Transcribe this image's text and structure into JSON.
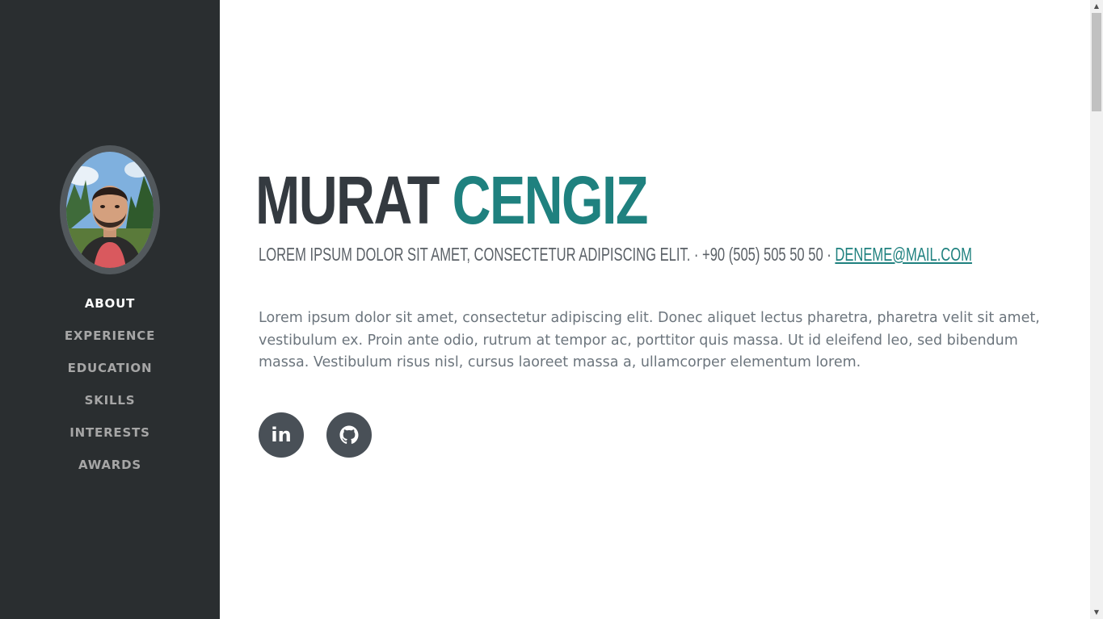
{
  "sidebar": {
    "avatar_alt": "Profile photo",
    "nav": [
      {
        "label": "ABOUT",
        "active": true
      },
      {
        "label": "EXPERIENCE",
        "active": false
      },
      {
        "label": "EDUCATION",
        "active": false
      },
      {
        "label": "SKILLS",
        "active": false
      },
      {
        "label": "INTERESTS",
        "active": false
      },
      {
        "label": "AWARDS",
        "active": false
      }
    ]
  },
  "about": {
    "first_name": "MURAT",
    "last_name": "CENGIZ",
    "tagline": "LOREM IPSUM DOLOR SIT AMET, CONSECTETUR ADIPISCING ELIT.",
    "separator": " · ",
    "phone": "+90 (505) 505 50 50",
    "email": "DENEME@MAIL.COM",
    "lead": "Lorem ipsum dolor sit amet, consectetur adipiscing elit. Donec aliquet lectus pharetra, pharetra velit sit amet, vestibulum ex. Proin ante odio, rutrum at tempor ac, porttitor quis massa. Ut id eleifend leo, sed bibendum massa. Vestibulum risus nisl, cursus laoreet massa a, ullamcorper elementum lorem."
  },
  "social": [
    {
      "name": "linkedin",
      "icon": "linkedin-icon",
      "glyph": "in"
    },
    {
      "name": "github",
      "icon": "github-icon"
    }
  ],
  "colors": {
    "sidebar_bg": "#2a2e30",
    "accent": "#1f817f",
    "heading": "#343a40",
    "text": "#6c757d",
    "social_bg": "#495057"
  }
}
